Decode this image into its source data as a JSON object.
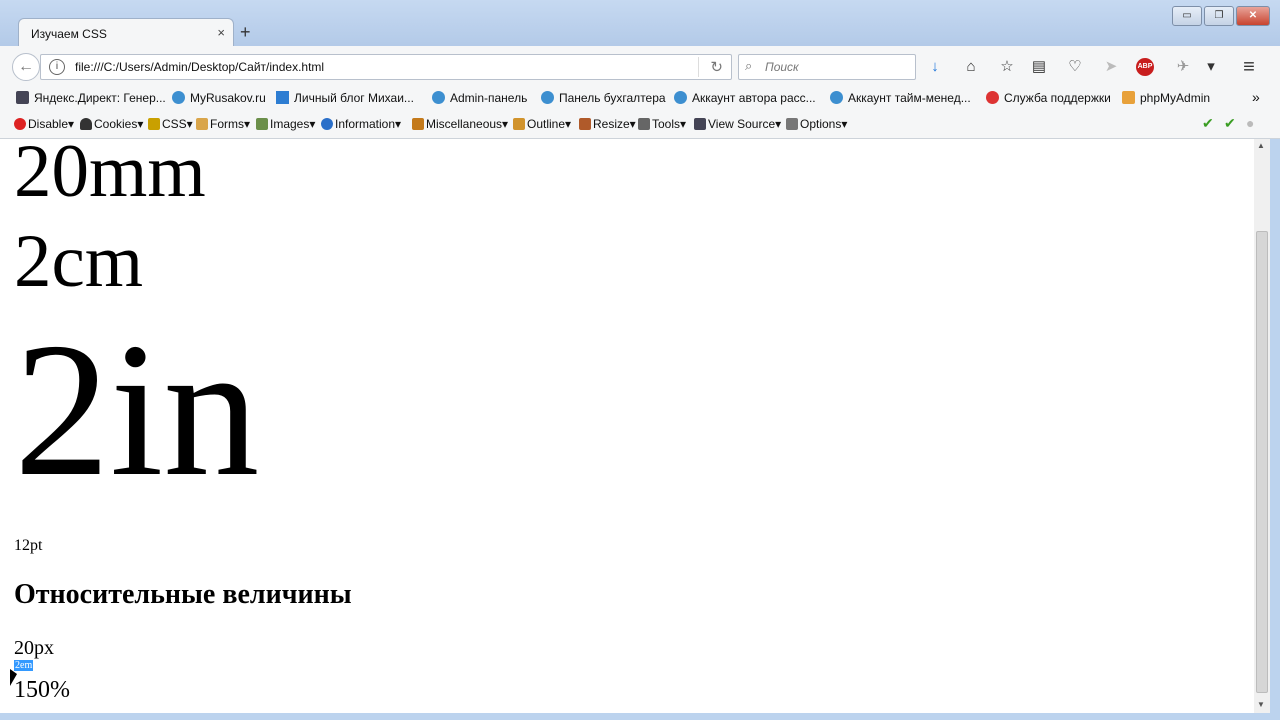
{
  "tab": {
    "title": "Изучаем CSS",
    "close": "×",
    "new_tab": "+"
  },
  "window_buttons": {
    "minimize": "▭",
    "maximize": "❐",
    "close": "✕"
  },
  "nav": {
    "back": "←",
    "url": "file:///C:/Users/Admin/Desktop/Сайт/index.html",
    "info": "i",
    "reload": "↻",
    "search_placeholder": "Поиск",
    "search_icon": "⌕",
    "icons": [
      "download-icon",
      "home-icon",
      "star-icon",
      "reading-list-icon",
      "pocket-icon",
      "send-icon",
      "adblock-icon",
      "extension-icon",
      "dropdown-icon",
      "menu-icon"
    ],
    "icon_glyphs": {
      "download": "↓",
      "home": "⌂",
      "star": "☆",
      "reading": "▤",
      "pocket": "♡",
      "send": "➤",
      "adblock": "ABP",
      "ext": "✈",
      "dropdown": "▾",
      "menu": "≡"
    }
  },
  "bookmarks": [
    "Яндекс.Директ: Генер...",
    "MyRusakov.ru",
    "Личный блог Михаи...",
    "Admin-панель",
    "Панель бухгалтера",
    "Аккаунт автора расс...",
    "Аккаунт тайм-менед...",
    "Служба поддержки",
    "phpMyAdmin"
  ],
  "bookmarks_more": "»",
  "webdev_toolbar": [
    "Disable▾",
    "Cookies▾",
    "CSS▾",
    "Forms▾",
    "Images▾",
    "Information▾",
    "Miscellaneous▾",
    "Outline▾",
    "Resize▾",
    "Tools▾",
    "View Source▾",
    "Options▾"
  ],
  "webdev_status": [
    "✔",
    "✔",
    "●"
  ],
  "page": {
    "t20mm": "20mm",
    "t2cm": "2cm",
    "t2in": "2in",
    "t12pt": "12pt",
    "heading": "Относительные величины",
    "t20px": "20px",
    "t2em": "2em",
    "t150": "150%"
  },
  "scrollbar": {
    "up": "▲",
    "down": "▼"
  }
}
